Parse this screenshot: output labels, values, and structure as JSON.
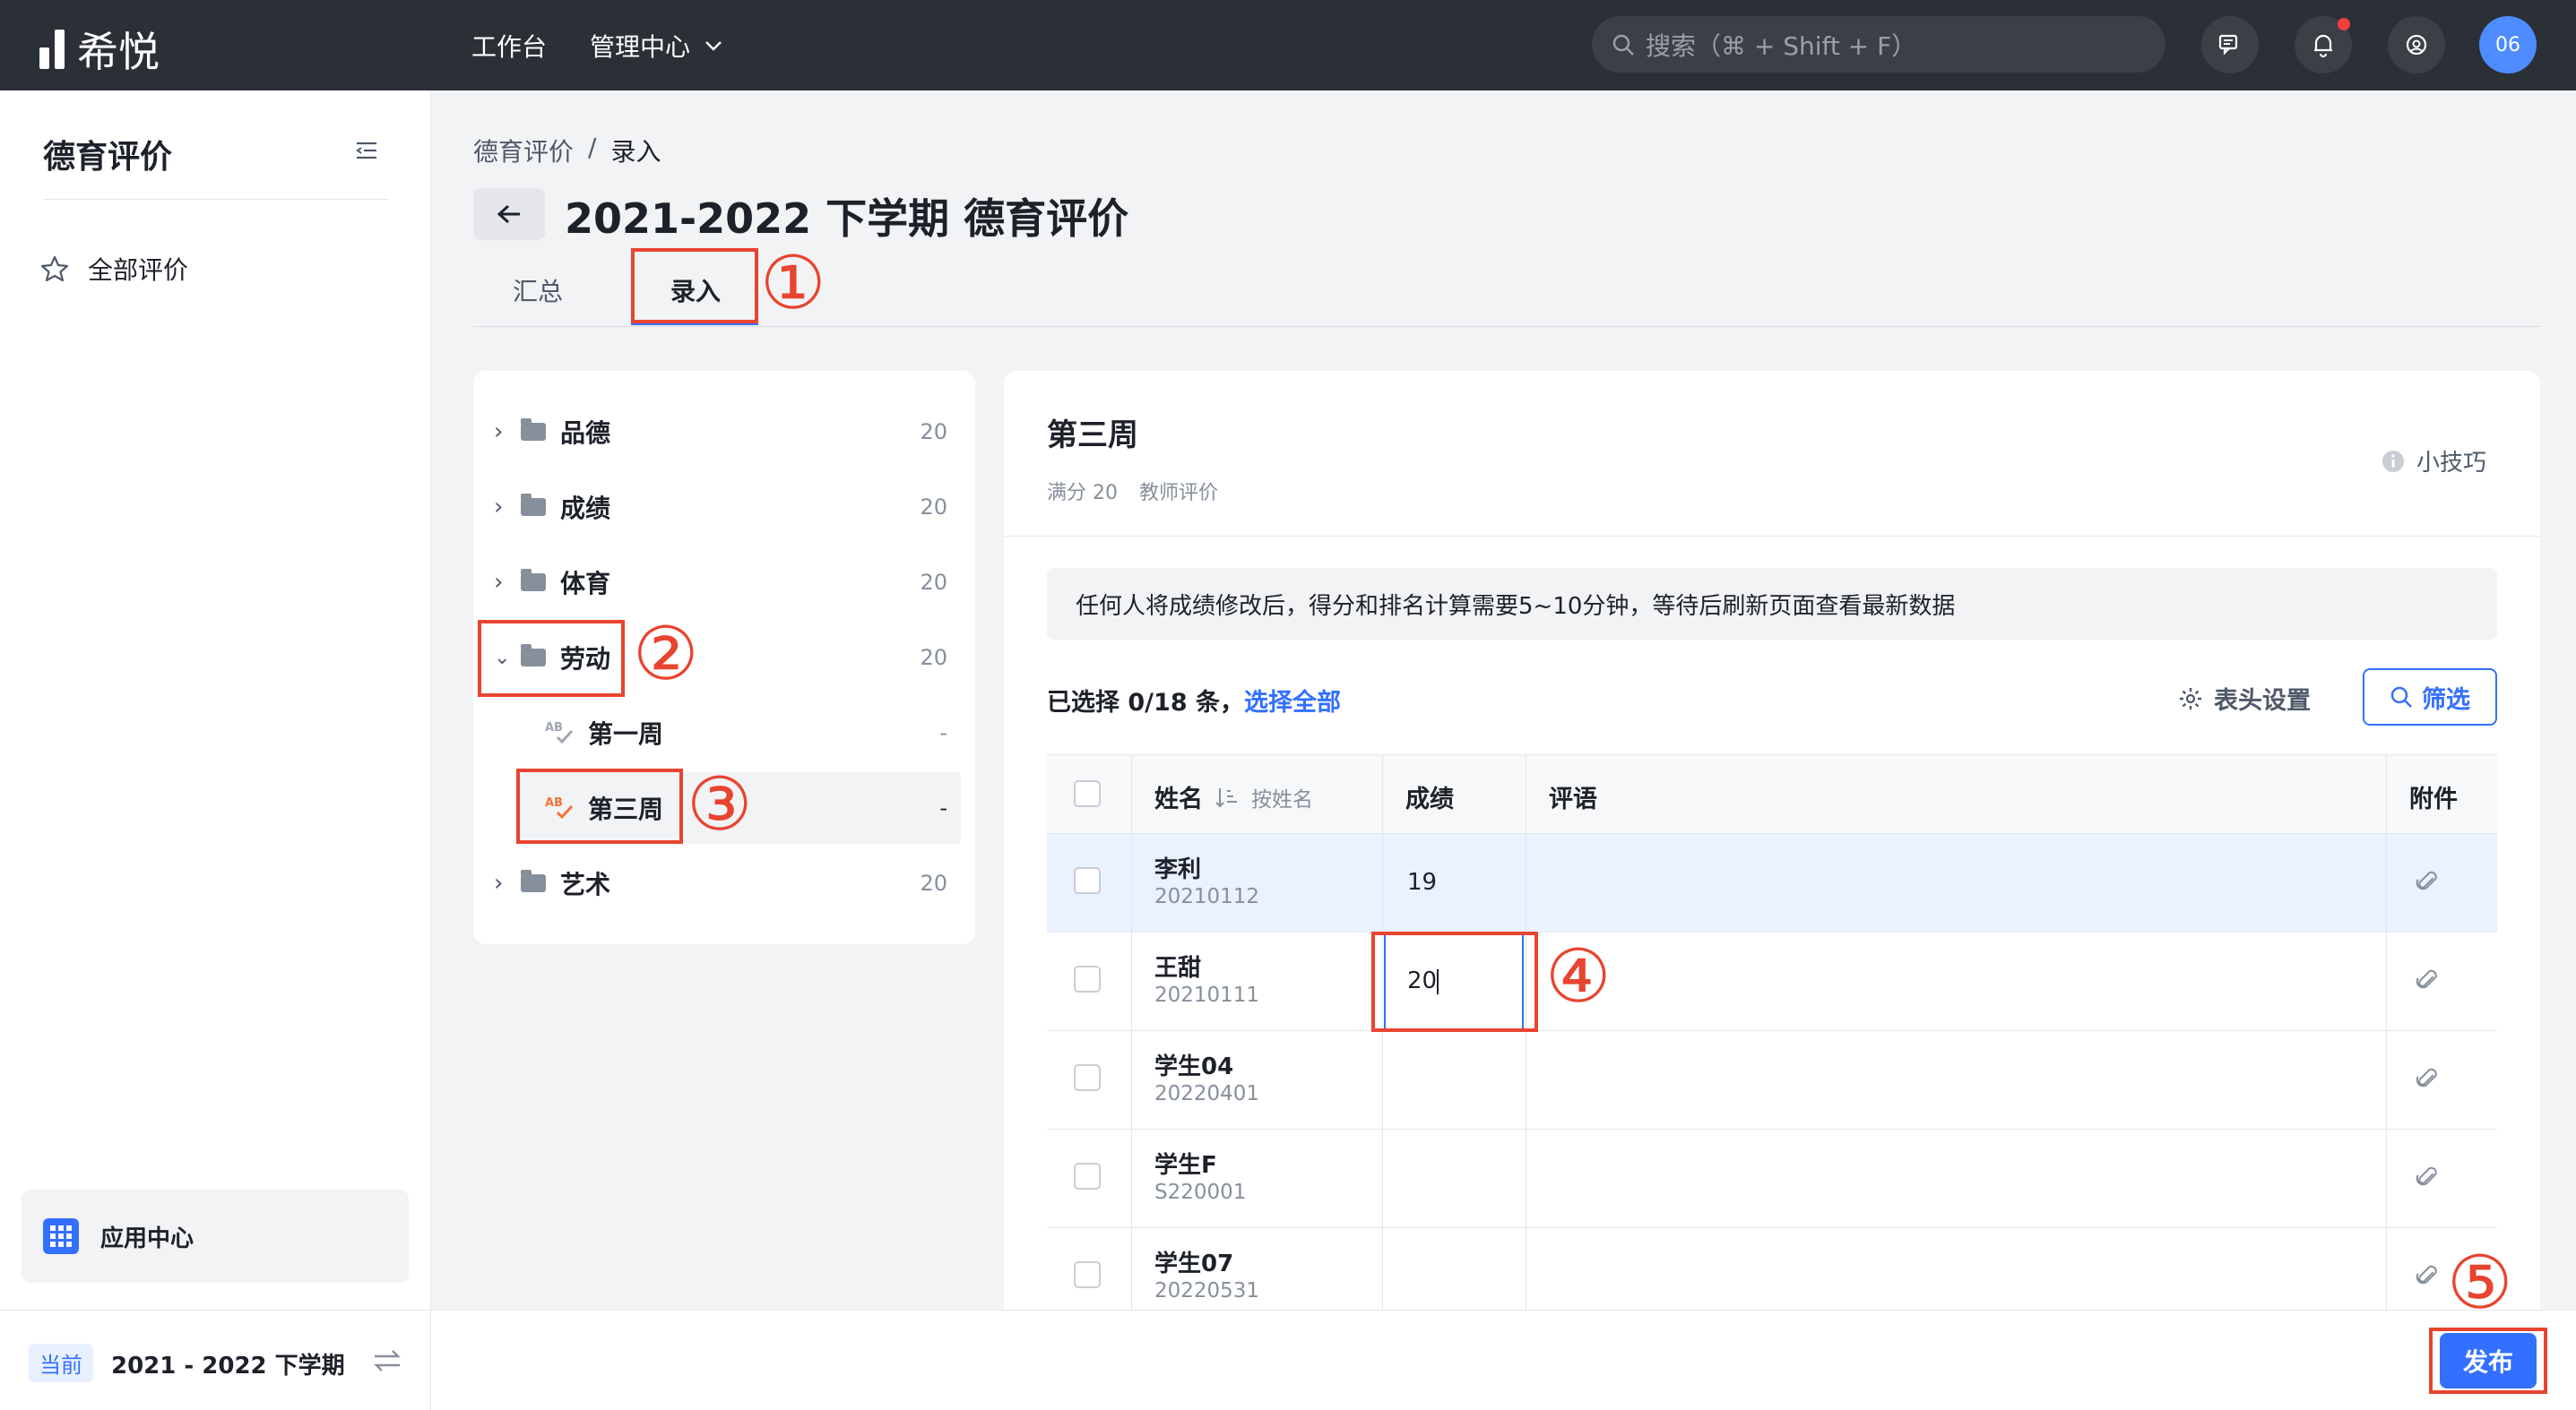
{
  "app": {
    "logo_text": "希悦"
  },
  "topnav": {
    "workbench": "工作台",
    "admin": "管理中心",
    "search_placeholder": "搜索（⌘ + Shift + F）",
    "avatar": "06"
  },
  "sidebar": {
    "title": "德育评价",
    "items": [
      {
        "label": "全部评价",
        "icon": "star-icon"
      }
    ],
    "app_center": "应用中心",
    "term_badge": "当前",
    "term": "2021 - 2022 下学期"
  },
  "breadcrumb": {
    "root": "德育评价",
    "sep": "/",
    "current": "录入"
  },
  "page": {
    "title": "2021-2022 下学期 德育评价",
    "tabs": [
      "汇总",
      "录入"
    ],
    "active_tab": 1
  },
  "steps": [
    "①",
    "②",
    "③",
    "④",
    "⑤"
  ],
  "tree": [
    {
      "label": "品德",
      "count": "20",
      "expanded": false
    },
    {
      "label": "成绩",
      "count": "20",
      "expanded": false
    },
    {
      "label": "体育",
      "count": "20",
      "expanded": false
    },
    {
      "label": "劳动",
      "count": "20",
      "expanded": true,
      "children": [
        {
          "label": "第一周",
          "count": "-"
        },
        {
          "label": "第三周",
          "count": "-",
          "selected": true
        }
      ]
    },
    {
      "label": "艺术",
      "count": "20",
      "expanded": false
    }
  ],
  "detail": {
    "title": "第三周",
    "meta": [
      "满分 20",
      "教师评价"
    ],
    "tips": "小技巧",
    "notice": "任何人将成绩修改后，得分和排名计算需要5~10分钟，等待后刷新页面查看最新数据",
    "selected_prefix": "已选择 0/18 条，",
    "select_all": "选择全部",
    "header_settings": "表头设置",
    "filter": "筛选"
  },
  "table": {
    "columns": {
      "name": "姓名",
      "sort": "按姓名",
      "score": "成绩",
      "comment": "评语",
      "attachment": "附件"
    },
    "rows": [
      {
        "name": "李利",
        "id": "20210112",
        "score": "19"
      },
      {
        "name": "王甜",
        "id": "20210111",
        "score": "20"
      },
      {
        "name": "学生04",
        "id": "20220401",
        "score": ""
      },
      {
        "name": "学生F",
        "id": "S220001",
        "score": ""
      },
      {
        "name": "学生07",
        "id": "20220531",
        "score": ""
      }
    ]
  },
  "footer": {
    "publish": "发布"
  },
  "colors": {
    "accent": "#3370ff",
    "annotation": "#e8442f",
    "topbar": "#2b2f36"
  }
}
